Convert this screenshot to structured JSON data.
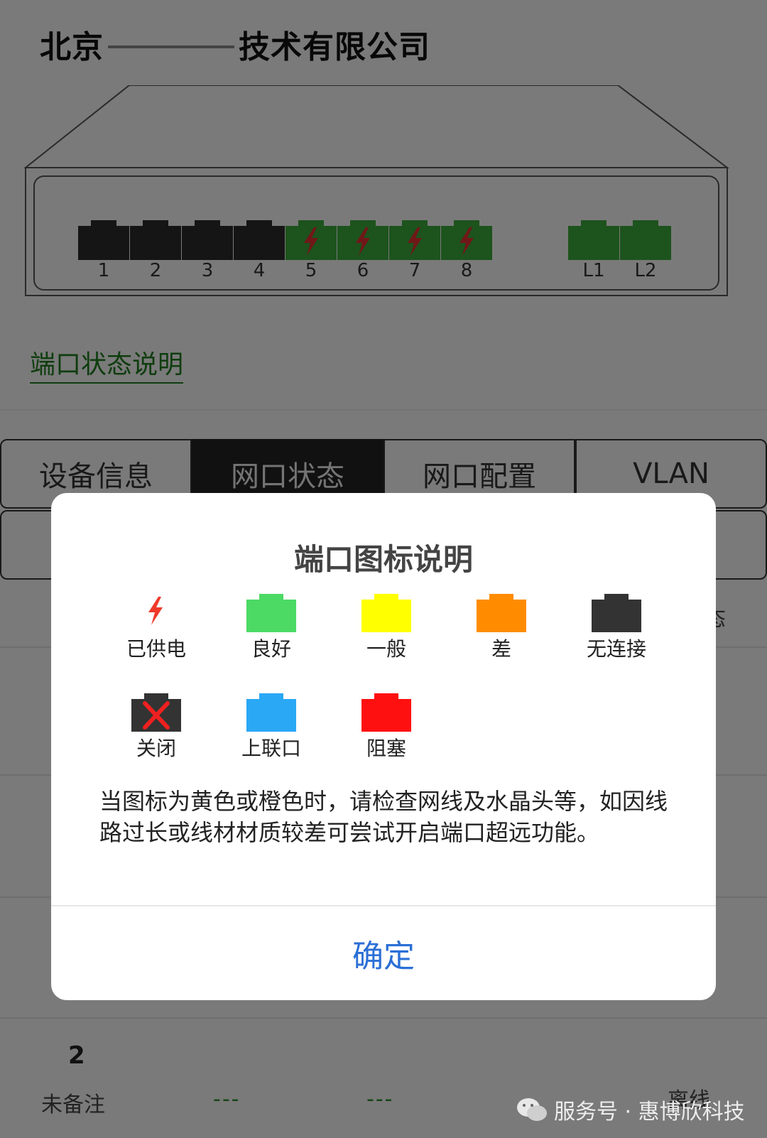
{
  "header": {
    "company_name_left": "北京",
    "company_name_right": "技术有限公司"
  },
  "switch": {
    "ports": [
      {
        "label": "1",
        "status": "disconnected",
        "powered": false
      },
      {
        "label": "2",
        "status": "disconnected",
        "powered": false
      },
      {
        "label": "3",
        "status": "disconnected",
        "powered": false
      },
      {
        "label": "4",
        "status": "disconnected",
        "powered": false
      },
      {
        "label": "5",
        "status": "good",
        "powered": true
      },
      {
        "label": "6",
        "status": "good",
        "powered": true
      },
      {
        "label": "7",
        "status": "good",
        "powered": true
      },
      {
        "label": "8",
        "status": "good",
        "powered": true
      }
    ],
    "uplinks": [
      {
        "label": "L1",
        "status": "good"
      },
      {
        "label": "L2",
        "status": "good"
      }
    ],
    "colors": {
      "disconnected": "#2a2a2a",
      "good": "#3aa63a",
      "bolt": "#e03030"
    }
  },
  "status_link": "端口状态说明",
  "tabs": [
    {
      "label": "设备信息",
      "active": false
    },
    {
      "label": "网口状态",
      "active": true
    },
    {
      "label": "网口配置",
      "active": false
    },
    {
      "label": "VLAN",
      "active": false
    }
  ],
  "background_list": {
    "column_tail": "态",
    "row_last": {
      "title": "2",
      "note": "未备注",
      "dash1": "---",
      "dash2": "---",
      "status": "离线"
    }
  },
  "modal": {
    "title": "端口图标说明",
    "legend": [
      {
        "icon": "power-bolt-icon",
        "label": "已供电",
        "color": "#f03a2a"
      },
      {
        "icon": "port-good-icon",
        "label": "良好",
        "color": "#4cd964"
      },
      {
        "icon": "port-fair-icon",
        "label": "一般",
        "color": "#ffff00"
      },
      {
        "icon": "port-poor-icon",
        "label": "差",
        "color": "#ff8c00"
      },
      {
        "icon": "port-disconnected-icon",
        "label": "无连接",
        "color": "#333333"
      },
      {
        "icon": "port-closed-icon",
        "label": "关闭",
        "color": "#333333"
      },
      {
        "icon": "port-uplink-icon",
        "label": "上联口",
        "color": "#2aa8f5"
      },
      {
        "icon": "port-blocked-icon",
        "label": "阻塞",
        "color": "#ff1010"
      }
    ],
    "description": "当图标为黄色或橙色时，请检查网线及水晶头等，如因线路过长或线材材质较差可尝试开启端口超远功能。",
    "confirm_label": "确定"
  },
  "watermark": {
    "text": "服务号 · 惠博欣科技",
    "icon": "wechat-icon"
  }
}
